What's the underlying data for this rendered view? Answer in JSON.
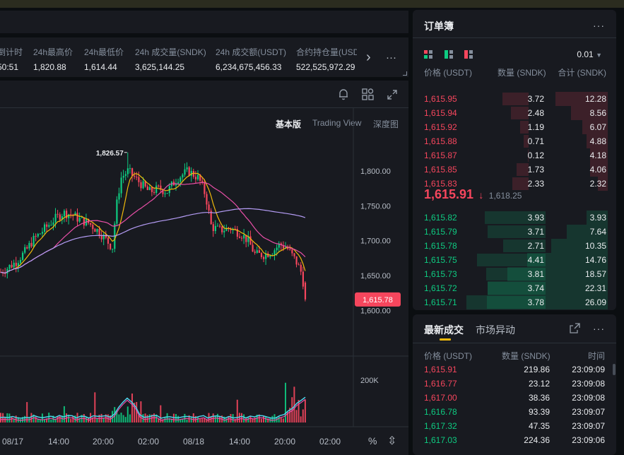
{
  "stats": [
    {
      "label": "倒计时",
      "value": "50:51"
    },
    {
      "label": "24h最高价",
      "value": "1,820.88"
    },
    {
      "label": "24h最低价",
      "value": "1,614.44"
    },
    {
      "label": "24h 成交量(SNDK)",
      "value": "3,625,144.25"
    },
    {
      "label": "24h 成交额(USDT)",
      "value": "6,234,675,456.33"
    },
    {
      "label": "合约持仓量(USDT)",
      "value": "522,525,972.29"
    }
  ],
  "stats_next_icon": "›",
  "stats_more_icon": "···",
  "chart_views": [
    {
      "label": "基本版",
      "active": true
    },
    {
      "label": "Trading View",
      "active": false
    },
    {
      "label": "深度图",
      "active": false
    }
  ],
  "chart_icons": [
    "bell-icon",
    "grid-icon",
    "expand-icon"
  ],
  "chart_data": {
    "type": "candlestick",
    "price_axis": [
      "1,800.00",
      "1,750.00",
      "1,700.00",
      "1,650.00",
      "1,600.00"
    ],
    "price_axis_values": [
      1800,
      1750,
      1700,
      1650,
      1600
    ],
    "ylim": [
      1560,
      1870
    ],
    "time_axis": [
      "08/17",
      "14:00",
      "20:00",
      "02:00",
      "08/18",
      "14:00",
      "20:00",
      "02:00"
    ],
    "high_marker": "1,826.57",
    "high_marker_value": 1826.57,
    "last_price_tag": "1,615.78",
    "last_price_value": 1615.78,
    "volume_axis": [
      "200K"
    ],
    "volume_axis_value": 200000,
    "colors": {
      "up": "#0ecb81",
      "down": "#f6465d",
      "ma7": "#f0b90b",
      "ma25": "#e84fa7",
      "ma99": "#b49cf5",
      "vol_ma": "#4dd2e9"
    }
  },
  "chart_footer_icons": {
    "percent": "%",
    "settings": "⇳"
  },
  "orderbook": {
    "title": "订单簿",
    "more_icon": "···",
    "tick": "0.01",
    "headers": {
      "price": "价格 (USDT)",
      "qty": "数量 (SNDK)",
      "total": "合计 (SNDK)"
    },
    "asks": [
      {
        "price": "1,615.95",
        "qty": "3.72",
        "total": "12.28",
        "depth": 0.47
      },
      {
        "price": "1,615.94",
        "qty": "2.48",
        "total": "8.56",
        "depth": 0.33
      },
      {
        "price": "1,615.92",
        "qty": "1.19",
        "total": "6.07",
        "depth": 0.23
      },
      {
        "price": "1,615.88",
        "qty": "0.71",
        "total": "4.88",
        "depth": 0.19
      },
      {
        "price": "1,615.87",
        "qty": "0.12",
        "total": "4.18",
        "depth": 0.16
      },
      {
        "price": "1,615.85",
        "qty": "1.73",
        "total": "4.06",
        "depth": 0.16
      },
      {
        "price": "1,615.83",
        "qty": "2.33",
        "total": "2.32",
        "depth": 0.09
      }
    ],
    "last_price": "1,615.91",
    "last_arrow": "↓",
    "mark_price": "1,618.25",
    "bids": [
      {
        "price": "1,615.82",
        "qty": "3.93",
        "total": "3.93",
        "depth": 0.15
      },
      {
        "price": "1,615.79",
        "qty": "3.71",
        "total": "7.64",
        "depth": 0.29
      },
      {
        "price": "1,615.78",
        "qty": "2.71",
        "total": "10.35",
        "depth": 0.4
      },
      {
        "price": "1,615.75",
        "qty": "4.41",
        "total": "14.76",
        "depth": 0.57
      },
      {
        "price": "1,615.73",
        "qty": "3.81",
        "total": "18.57",
        "depth": 0.71
      },
      {
        "price": "1,615.72",
        "qty": "3.74",
        "total": "22.31",
        "depth": 0.85
      },
      {
        "price": "1,615.71",
        "qty": "3.78",
        "total": "26.09",
        "depth": 1.0
      }
    ]
  },
  "trades": {
    "tabs": [
      {
        "label": "最新成交",
        "active": true
      },
      {
        "label": "市场异动",
        "active": false
      }
    ],
    "headers": {
      "price": "价格 (USDT)",
      "qty": "数量 (SNDK)",
      "time": "时间"
    },
    "rows": [
      {
        "price": "1,615.91",
        "qty": "219.86",
        "time": "23:09:09",
        "side": "down"
      },
      {
        "price": "1,616.77",
        "qty": "23.12",
        "time": "23:09:08",
        "side": "down"
      },
      {
        "price": "1,617.00",
        "qty": "38.36",
        "time": "23:09:08",
        "side": "down"
      },
      {
        "price": "1,616.78",
        "qty": "93.39",
        "time": "23:09:07",
        "side": "up"
      },
      {
        "price": "1,617.32",
        "qty": "47.35",
        "time": "23:09:07",
        "side": "up"
      },
      {
        "price": "1,617.03",
        "qty": "224.36",
        "time": "23:09:06",
        "side": "up"
      }
    ]
  }
}
